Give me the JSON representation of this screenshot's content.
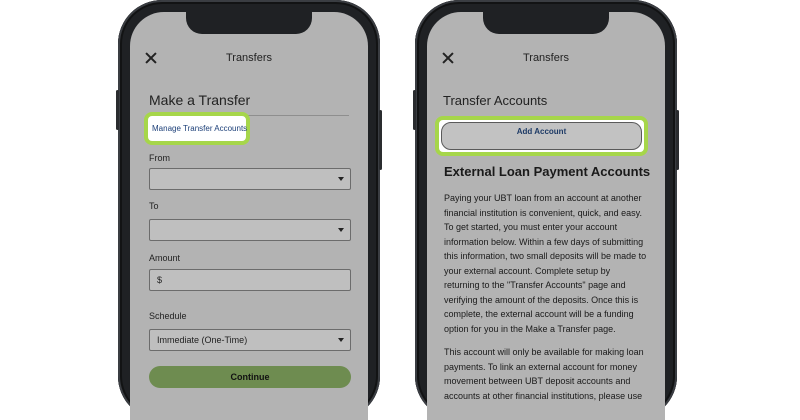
{
  "left_screen": {
    "header_title": "Transfers",
    "page_title": "Make a Transfer",
    "manage_link": "Manage Transfer Accounts",
    "from_label": "From",
    "from_value": "",
    "to_label": "To",
    "to_value": "",
    "amount_label": "Amount",
    "amount_value": "$",
    "schedule_label": "Schedule",
    "schedule_value": "Immediate (One-Time)",
    "continue_label": "Continue"
  },
  "right_screen": {
    "header_title": "Transfers",
    "page_title": "Transfer Accounts",
    "add_account_label": "Add Account",
    "section_title": "External Loan Payment Accounts",
    "paragraph_1": "Paying your UBT loan from an account at another financial institution is convenient, quick, and easy. To get started, you must enter your account information below. Within a few days of submitting this information, two small deposits will be made to your external account. Complete setup by returning to the \"Transfer Accounts\" page and verifying the amount of the deposits. Once this is complete, the external account will be a funding option for you in the Make a Transfer page.",
    "paragraph_2": "This account will only be available for making loan payments. To link an external account for money movement between UBT deposit accounts and accounts at other financial institutions, please use"
  },
  "colors": {
    "highlight": "#a6d64a",
    "continue_button": "#6e8c50",
    "link": "#1d4079"
  },
  "icons": [
    "close-icon",
    "chevron-down-icon"
  ]
}
